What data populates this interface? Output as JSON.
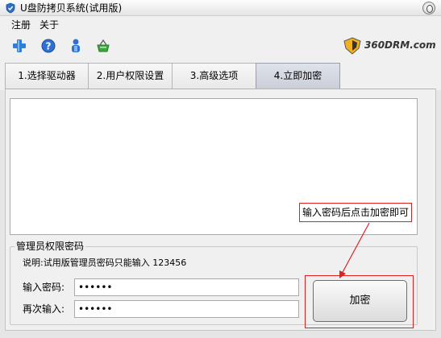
{
  "window": {
    "title": "U盘防拷贝系统(试用版)"
  },
  "menu": {
    "items": [
      "注册",
      "关于"
    ]
  },
  "toolbar": {
    "buttons": [
      "add-icon",
      "help-icon",
      "user-icon",
      "basket-icon"
    ],
    "logo_text": "360DRM.com"
  },
  "tabs": [
    {
      "label": "1.选择驱动器",
      "active": false
    },
    {
      "label": "2.用户权限设置",
      "active": false
    },
    {
      "label": "3.高级选项",
      "active": false
    },
    {
      "label": "4.立即加密",
      "active": true
    }
  ],
  "callout": {
    "text": "输入密码后点击加密即可"
  },
  "admin_password": {
    "group_title": "管理员权限密码",
    "note": "说明:试用版管理员密码只能输入 123456",
    "password_label": "输入密码:",
    "password_value": "123456",
    "confirm_label": "再次输入:",
    "confirm_value": "123456"
  },
  "encrypt_button": {
    "label": "加密"
  },
  "colors": {
    "accent_red": "#e02020",
    "active_tab": "#c9ced8"
  }
}
